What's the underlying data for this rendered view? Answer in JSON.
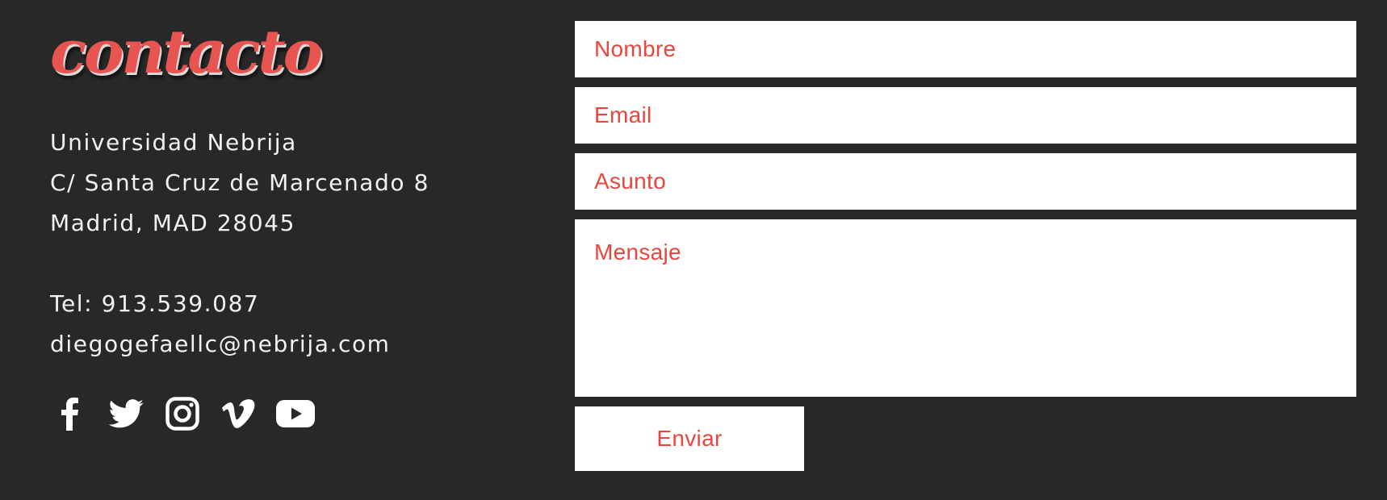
{
  "brand": {
    "title": "contacto",
    "accent_color": "#e85550"
  },
  "address": {
    "lines": [
      "Universidad Nebrija",
      "C/ Santa Cruz de Marcenado 8",
      "Madrid, MAD 28045"
    ]
  },
  "contact": {
    "phone": "Tel: 913.539.087",
    "email": "diegogefaellc@nebrija.com"
  },
  "social": [
    {
      "icon": "facebook-icon"
    },
    {
      "icon": "twitter-icon"
    },
    {
      "icon": "instagram-icon"
    },
    {
      "icon": "vimeo-icon"
    },
    {
      "icon": "youtube-icon"
    }
  ],
  "form": {
    "name_placeholder": "Nombre",
    "email_placeholder": "Email",
    "subject_placeholder": "Asunto",
    "message_placeholder": "Mensaje",
    "submit_label": "Enviar",
    "placeholder_color": "#e8463f"
  },
  "colors": {
    "background": "#282828",
    "text": "#f2f2f2",
    "field_background": "#ffffff"
  }
}
